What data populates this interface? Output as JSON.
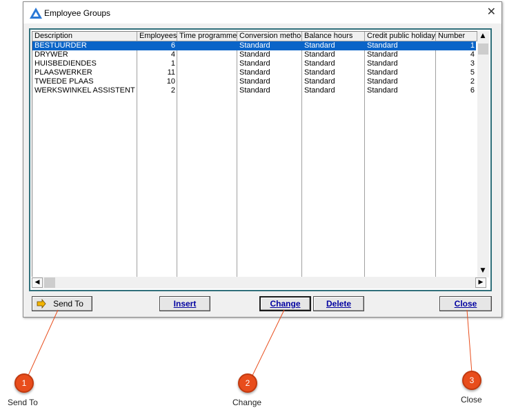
{
  "window": {
    "title": "Employee Groups",
    "close_glyph": "✕"
  },
  "table": {
    "columns": [
      "Description",
      "Employees",
      "Time programme",
      "Conversion method",
      "Balance hours",
      "Credit public holiday",
      "Number"
    ],
    "rows": [
      {
        "description": "BESTUURDER",
        "employees": "6",
        "time_programme": "",
        "conversion": "Standard",
        "balance": "Standard",
        "credit": "Standard",
        "number": "1",
        "selected": true
      },
      {
        "description": "DRYWER",
        "employees": "4",
        "time_programme": "",
        "conversion": "Standard",
        "balance": "Standard",
        "credit": "Standard",
        "number": "4"
      },
      {
        "description": "HUISBEDIENDES",
        "employees": "1",
        "time_programme": "",
        "conversion": "Standard",
        "balance": "Standard",
        "credit": "Standard",
        "number": "3"
      },
      {
        "description": "PLAASWERKER",
        "employees": "11",
        "time_programme": "",
        "conversion": "Standard",
        "balance": "Standard",
        "credit": "Standard",
        "number": "5"
      },
      {
        "description": "TWEEDE PLAAS",
        "employees": "10",
        "time_programme": "",
        "conversion": "Standard",
        "balance": "Standard",
        "credit": "Standard",
        "number": "2"
      },
      {
        "description": "WERKSWINKEL ASSISTENT",
        "employees": "2",
        "time_programme": "",
        "conversion": "Standard",
        "balance": "Standard",
        "credit": "Standard",
        "number": "6"
      }
    ]
  },
  "buttons": {
    "send_to": "Send To",
    "insert": "Insert",
    "change": "Change",
    "delete": "Delete",
    "close": "Close"
  },
  "callouts": [
    {
      "number": "1",
      "label": "Send To"
    },
    {
      "number": "2",
      "label": "Change"
    },
    {
      "number": "3",
      "label": "Close"
    }
  ],
  "colors": {
    "selection": "#0a64c8",
    "badge": "#e84d1c",
    "link_button_text": "#0000a0"
  }
}
